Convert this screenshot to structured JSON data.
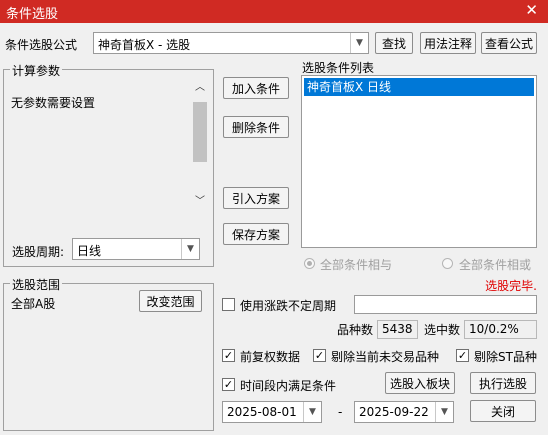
{
  "window": {
    "title": "条件选股",
    "close_glyph": "✕"
  },
  "formula": {
    "label": "条件选股公式",
    "value": "神奇首板X  -  选股"
  },
  "buttons": {
    "find": "查找",
    "usage": "用法注释",
    "view_formula": "查看公式",
    "add_condition": "加入条件",
    "delete_condition": "删除条件",
    "import_plan": "引入方案",
    "save_plan": "保存方案",
    "change_range": "改变范围",
    "select_to_block": "选股入板块",
    "run_select": "执行选股",
    "close": "关闭"
  },
  "params": {
    "group_label": "计算参数",
    "message": "无参数需要设置",
    "period_label": "选股周期:",
    "period_value": "日线"
  },
  "conditions": {
    "label": "选股条件列表",
    "items": [
      "神奇首板X  日线"
    ],
    "radio_and": "全部条件相与",
    "radio_or": "全部条件相或",
    "status": "选股完毕."
  },
  "range": {
    "group_label": "选股范围",
    "value": "全部A股"
  },
  "options": {
    "unfixed_period": "使用涨跌不定周期",
    "count_label": "品种数",
    "count_value": "5438",
    "selected_label": "选中数",
    "selected_value": "10/0.2%",
    "pre_adjust": "前复权数据",
    "exclude_no_trade": "剔除当前未交易品种",
    "exclude_st": "剔除ST品种",
    "time_range": "时间段内满足条件",
    "date_from": "2025-08-01",
    "date_to": "2025-09-22",
    "dash": "-",
    "checkmark": "✓"
  },
  "colors": {
    "title_bar": "#d02a23",
    "selection": "#0078d7",
    "status": "#e00000"
  }
}
